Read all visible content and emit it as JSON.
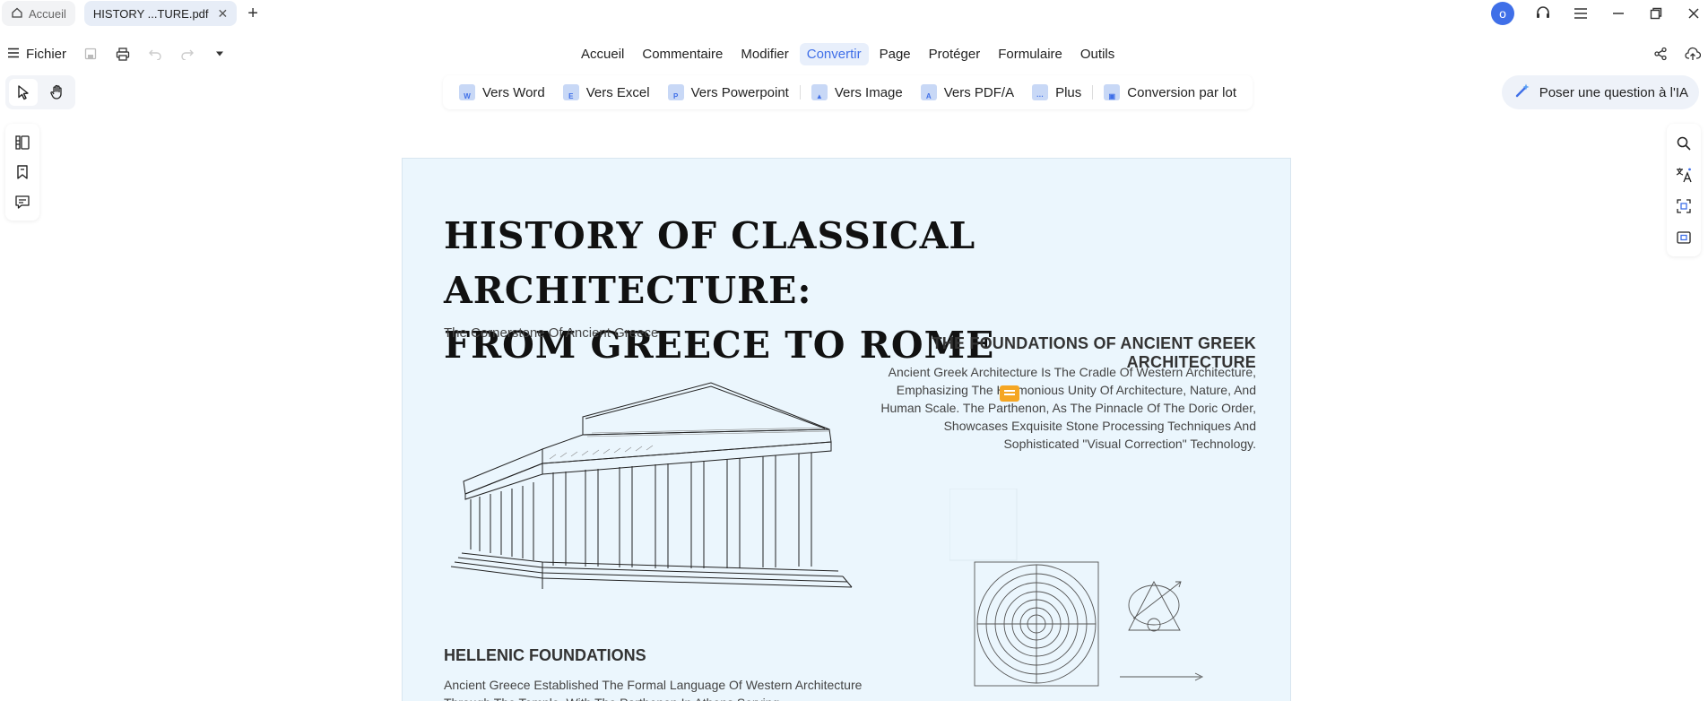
{
  "tabs": {
    "home_label": "Accueil",
    "file_label": "HISTORY ...TURE.pdf"
  },
  "user": {
    "avatar_letter": "o"
  },
  "menubar": {
    "file_label": "Fichier",
    "items": [
      "Accueil",
      "Commentaire",
      "Modifier",
      "Convertir",
      "Page",
      "Protéger",
      "Formulaire",
      "Outils"
    ],
    "active_item": "Convertir"
  },
  "convert_toolbar": {
    "items": [
      "Vers Word",
      "Vers Excel",
      "Vers Powerpoint",
      "Vers Image",
      "Vers PDF/A",
      "Plus",
      "Conversion par lot"
    ]
  },
  "ai_button": {
    "label": "Poser une question à l'IA"
  },
  "document": {
    "title_line1": "HISTORY OF CLASSICAL  ARCHITECTURE:",
    "title_line2": "FROM GREECE TO ROME",
    "subtitle": "The Cornerstone Of Ancient Greece",
    "section_heading": "THE FOUNDATIONS OF ANCIENT GREEK ARCHITECTURE",
    "section_body": "Ancient Greek Architecture Is The Cradle Of Western Architecture, Emphasizing The Harmonious Unity Of Architecture, Nature, And Human Scale. The Parthenon, As The Pinnacle Of The Doric Order, Showcases Exquisite Stone Processing Techniques And Sophisticated \"Visual Correction\" Technology.",
    "hellenic_heading": "HELLENIC FOUNDATIONS",
    "hellenic_body": "Ancient Greece Established The Formal Language Of Western Architecture Through The Temple, With The Parthenon In Athens Serving"
  },
  "colors": {
    "accent": "#3f6fe8",
    "page_bg": "#ebf6fd",
    "active_menu_bg": "#e8effb",
    "comment_note": "#f5a623"
  }
}
